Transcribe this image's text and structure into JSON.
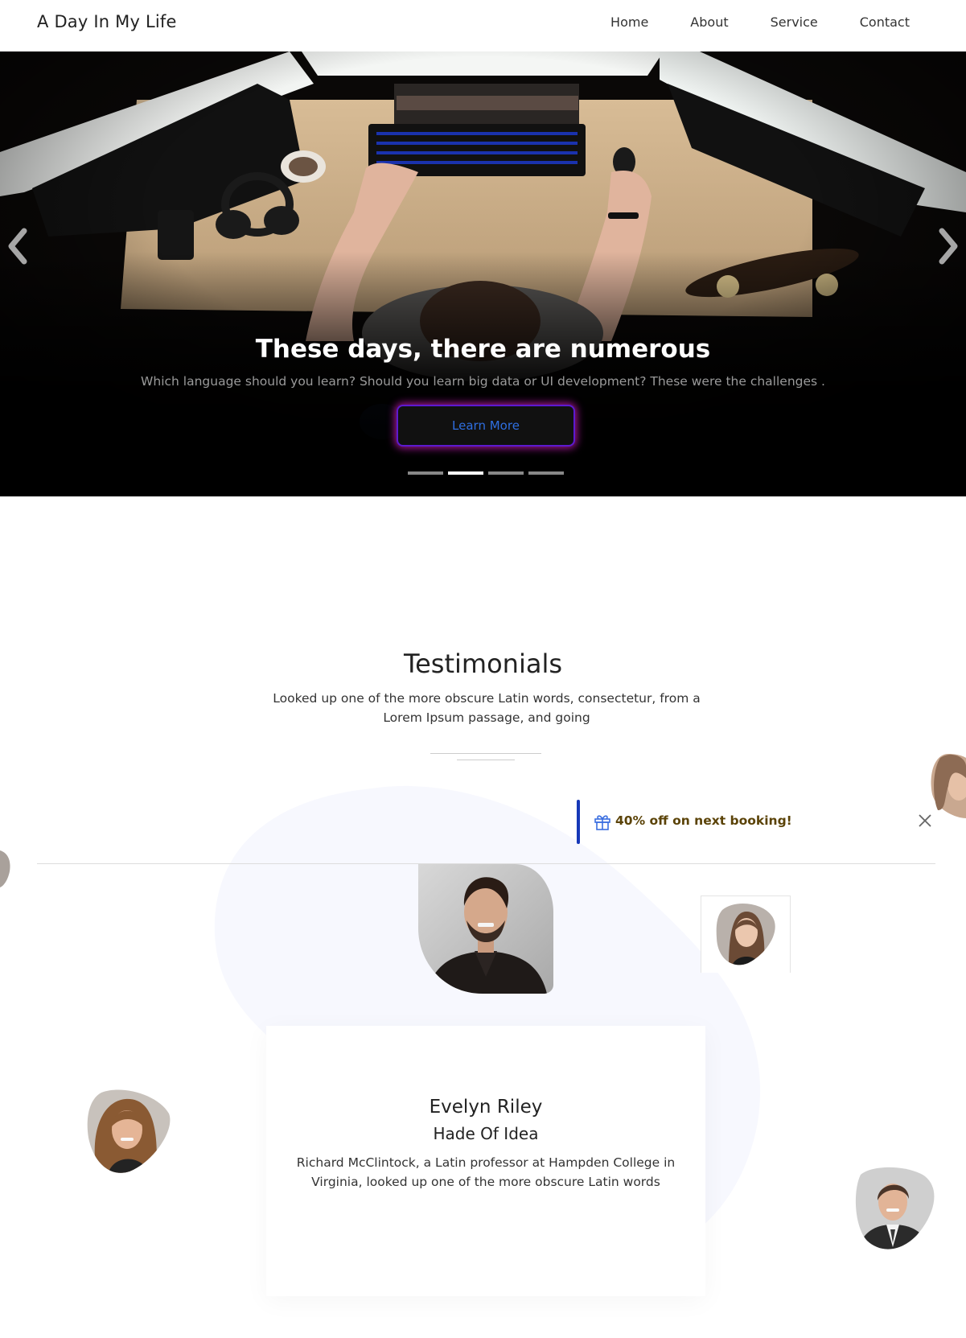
{
  "nav": {
    "brand": "A Day In My Life",
    "items": [
      "Home",
      "About",
      "Service",
      "Contact"
    ]
  },
  "hero": {
    "title": "These days, there are numerous",
    "subtitle": "Which language should you learn? Should you learn big data or UI development? These were the challenges .",
    "button_label": "Learn More",
    "slide_count": 4,
    "active_slide": 2
  },
  "testimonials": {
    "title": "Testimonials",
    "subtitle": "Looked up one of the more obscure Latin words, consectetur, from a Lorem Ipsum passage, and going",
    "promo_text": "40% off on next booking!",
    "card": {
      "name": "Evelyn Riley",
      "role": "Hade Of Idea",
      "text": "Richard McClintock, a Latin professor at Hampden College in Virginia, looked up one of the more obscure Latin words"
    }
  },
  "icons": {
    "prev": "chevron-left-icon",
    "next": "chevron-right-icon",
    "gift": "gift-icon",
    "close": "close-icon"
  },
  "colors": {
    "promo_bar": "#1638b8",
    "promo_text": "#5b4308",
    "button_text": "#2f6fe0",
    "button_glow": "#dc1ec8"
  }
}
